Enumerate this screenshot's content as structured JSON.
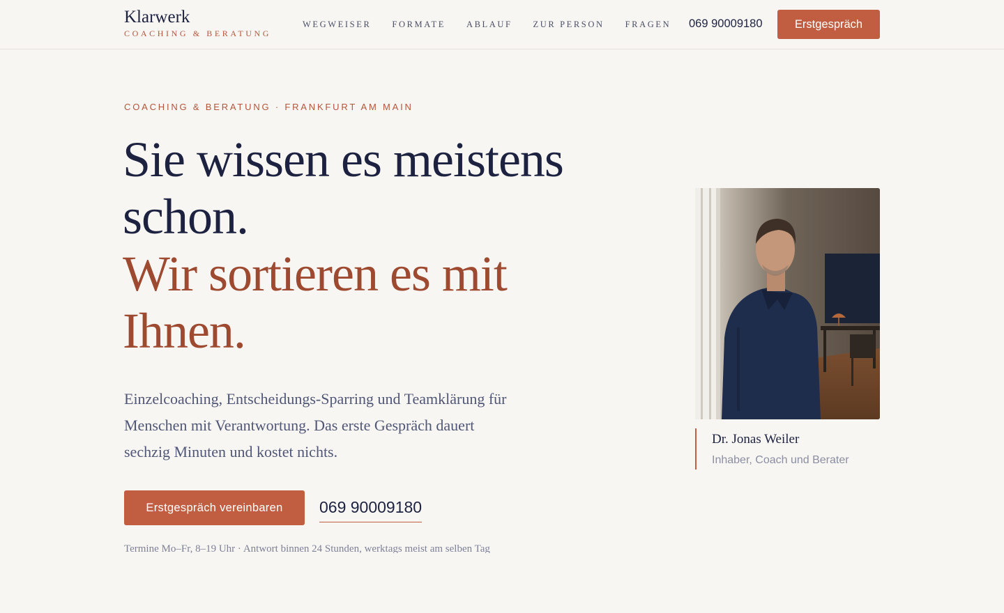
{
  "header": {
    "brand_name": "Klarwerk",
    "brand_tagline": "COACHING & BERATUNG",
    "nav": [
      {
        "label": "WEGWEISER"
      },
      {
        "label": "FORMATE"
      },
      {
        "label": "ABLAUF"
      },
      {
        "label": "ZUR PERSON"
      },
      {
        "label": "FRAGEN"
      }
    ],
    "phone": "069 90009180",
    "cta_label": "Erstgespräch"
  },
  "hero": {
    "eyebrow": "COACHING & BERATUNG · FRANKFURT AM MAIN",
    "title_line1": "Sie wissen es meistens schon.",
    "title_line2": "Wir sortieren es mit Ihnen.",
    "lead": "Einzelcoaching, Entscheidungs-Sparring und Teamklärung für Menschen mit Verantwortung. Das erste Gespräch dauert sechzig Minuten und kostet nichts.",
    "cta_label": "Erstgespräch vereinbaren",
    "phone": "069 90009180",
    "note": "Termine Mo–Fr, 8–19 Uhr · Antwort binnen 24 Stunden, werktags meist am selben Tag"
  },
  "portrait": {
    "name": "Dr. Jonas Weiler",
    "role": "Inhaber, Coach und Berater"
  },
  "colors": {
    "background": "#f8f6f3",
    "navy": "#1c2240",
    "accent": "#c15d40",
    "accent_text": "#9e4a30"
  }
}
